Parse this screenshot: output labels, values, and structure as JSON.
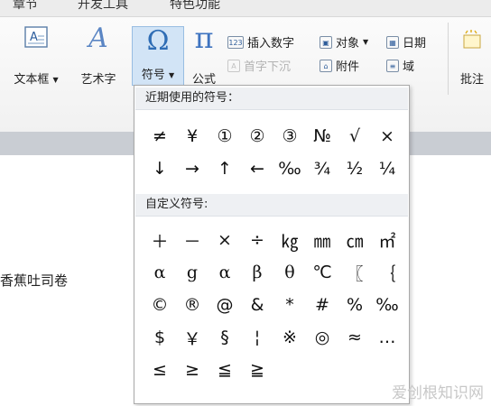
{
  "tabs": [
    "章节",
    "开发工具",
    "特色功能"
  ],
  "ribbon": {
    "text_box": {
      "label": "文本框",
      "icon": "text-box-icon"
    },
    "art_text": {
      "label": "艺术字",
      "icon": "art-text-icon",
      "glyph": "A"
    },
    "symbol": {
      "label": "符号",
      "icon": "omega-icon",
      "glyph": "Ω"
    },
    "formula": {
      "label": "公式",
      "icon": "pi-icon",
      "glyph": "π"
    },
    "insert_number": {
      "label": "插入数字",
      "icon_text": "123"
    },
    "object": {
      "label": "对象"
    },
    "date": {
      "label": "日期"
    },
    "drop_cap": {
      "label": "首字下沉"
    },
    "attachment": {
      "label": "附件"
    },
    "field": {
      "label": "域"
    },
    "comment": {
      "label": "批注"
    }
  },
  "dropdown": {
    "recent_header": "近期使用的符号：",
    "recent_symbols": [
      "≠",
      "¥",
      "①",
      "②",
      "③",
      "№",
      "√",
      "×",
      "↓",
      "→",
      "↑",
      "←",
      "‰",
      "¾",
      "½",
      "¼"
    ],
    "custom_header": "自定义符号:",
    "custom_symbols": [
      "＋",
      "－",
      "×",
      "÷",
      "㎏",
      "㎜",
      "㎝",
      "㎡",
      "α",
      "g",
      "α",
      "β",
      "θ",
      "℃",
      "〖",
      "｛",
      "©",
      "®",
      "@",
      "&",
      "*",
      "#",
      "%",
      "‰",
      "$",
      "￥",
      "§",
      "¦",
      "※",
      "◎",
      "≈",
      "…",
      "≤",
      "≥",
      "≦",
      "≧"
    ]
  },
  "document": {
    "text": "香蕉吐司卷"
  },
  "watermark": "爱创根知识网"
}
